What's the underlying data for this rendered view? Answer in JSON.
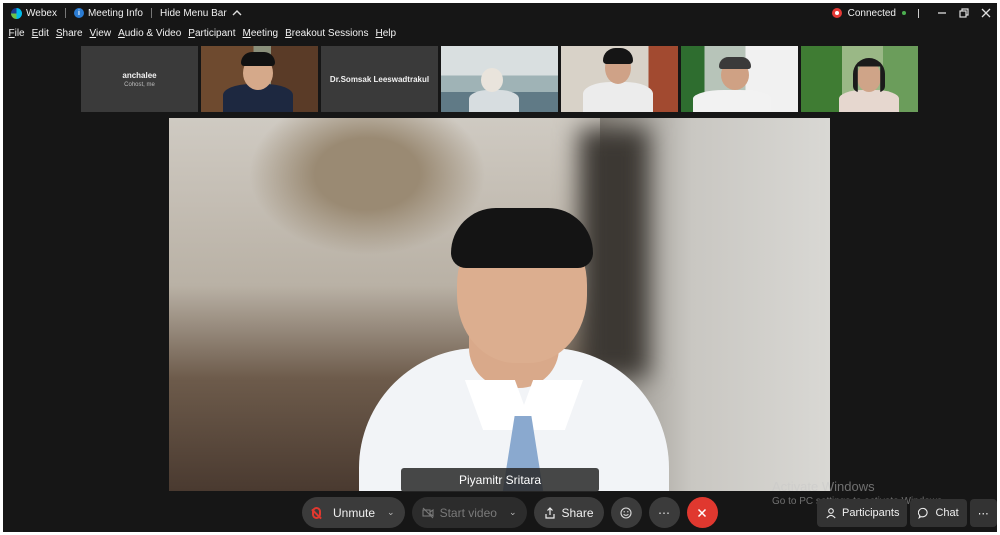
{
  "titlebar": {
    "app_name": "Webex",
    "meeting_info": "Meeting Info",
    "hide_menu_bar": "Hide Menu Bar",
    "connection_status": "Connected"
  },
  "menu": [
    "File",
    "Edit",
    "Share",
    "View",
    "Audio & Video",
    "Participant",
    "Meeting",
    "Breakout Sessions",
    "Help"
  ],
  "thumbnails": [
    {
      "name": "anchalee",
      "subtitle": "Cohost, me",
      "video": false
    },
    {
      "name": "",
      "subtitle": "",
      "video": true
    },
    {
      "name": "Dr.Somsak Leeswadtrakul",
      "subtitle": "",
      "video": false
    },
    {
      "name": "",
      "subtitle": "",
      "video": true
    },
    {
      "name": "",
      "subtitle": "",
      "video": true
    },
    {
      "name": "",
      "subtitle": "",
      "video": true
    },
    {
      "name": "",
      "subtitle": "",
      "video": true
    }
  ],
  "main_video": {
    "speaker_name": "Piyamitr Sritara"
  },
  "watermark": {
    "line1": "Activate Windows",
    "line2": "Go to PC settings to activate Windows."
  },
  "controls": {
    "unmute": "Unmute",
    "start_video": "Start video",
    "share": "Share",
    "participants": "Participants",
    "chat": "Chat"
  },
  "colors": {
    "background": "#161616",
    "end_call": "#e0382f",
    "mute": "#e0382f",
    "connected": "#4caf50"
  }
}
